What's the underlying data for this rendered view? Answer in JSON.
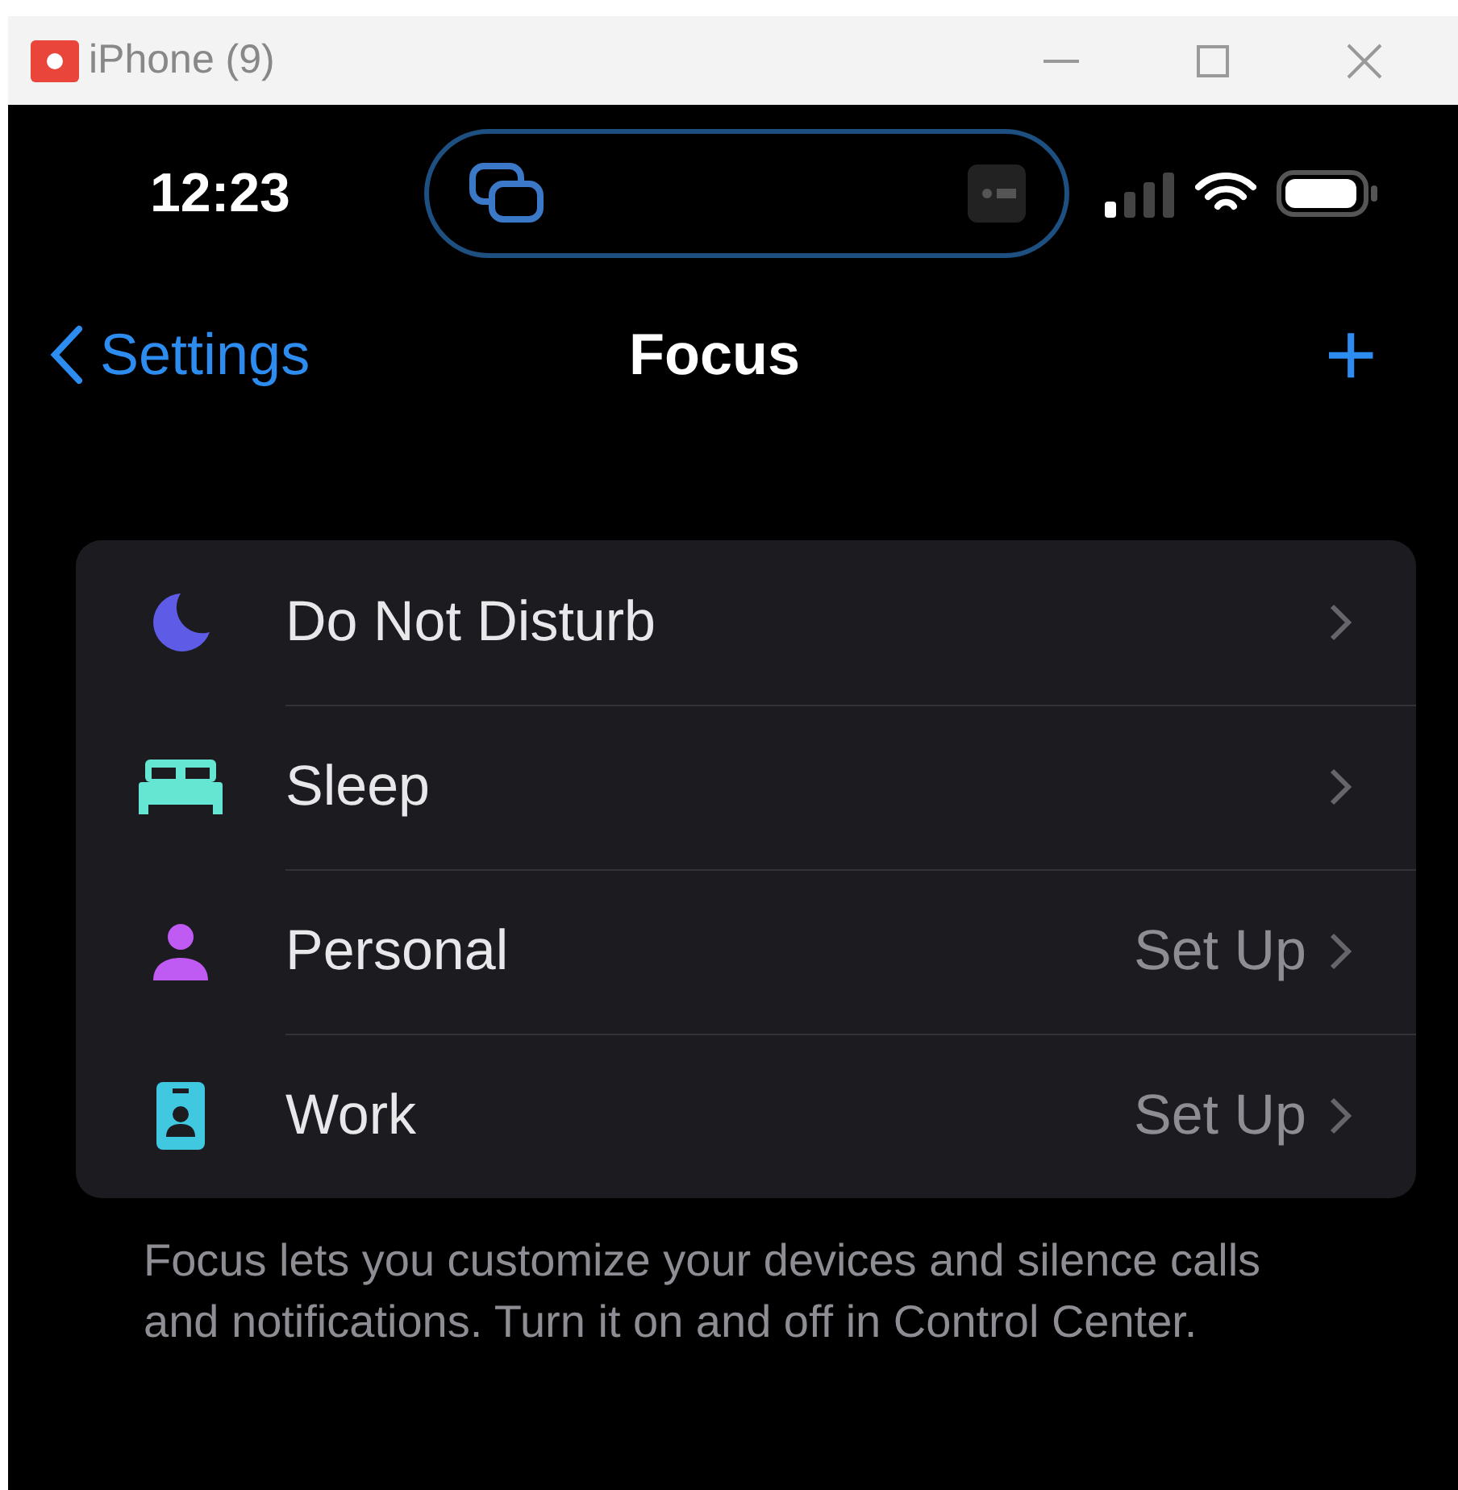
{
  "window": {
    "title": "iPhone (9)"
  },
  "status_bar": {
    "time": "12:23"
  },
  "nav": {
    "back": "Settings",
    "title": "Focus",
    "add": "+"
  },
  "focus_modes": [
    {
      "kind": "moon",
      "label": "Do Not Disturb",
      "color": "#5e5ce6"
    },
    {
      "kind": "bed",
      "label": "Sleep",
      "color": "#64e6d2"
    },
    {
      "kind": "person",
      "label": "Personal",
      "color": "#bf5af2",
      "detail": "Set Up"
    },
    {
      "kind": "badge",
      "label": "Work",
      "color": "#40c8e0",
      "detail": "Set Up"
    }
  ],
  "footer": "Focus lets you customize your devices and silence calls and notifications. Turn it on and off in Control Center."
}
